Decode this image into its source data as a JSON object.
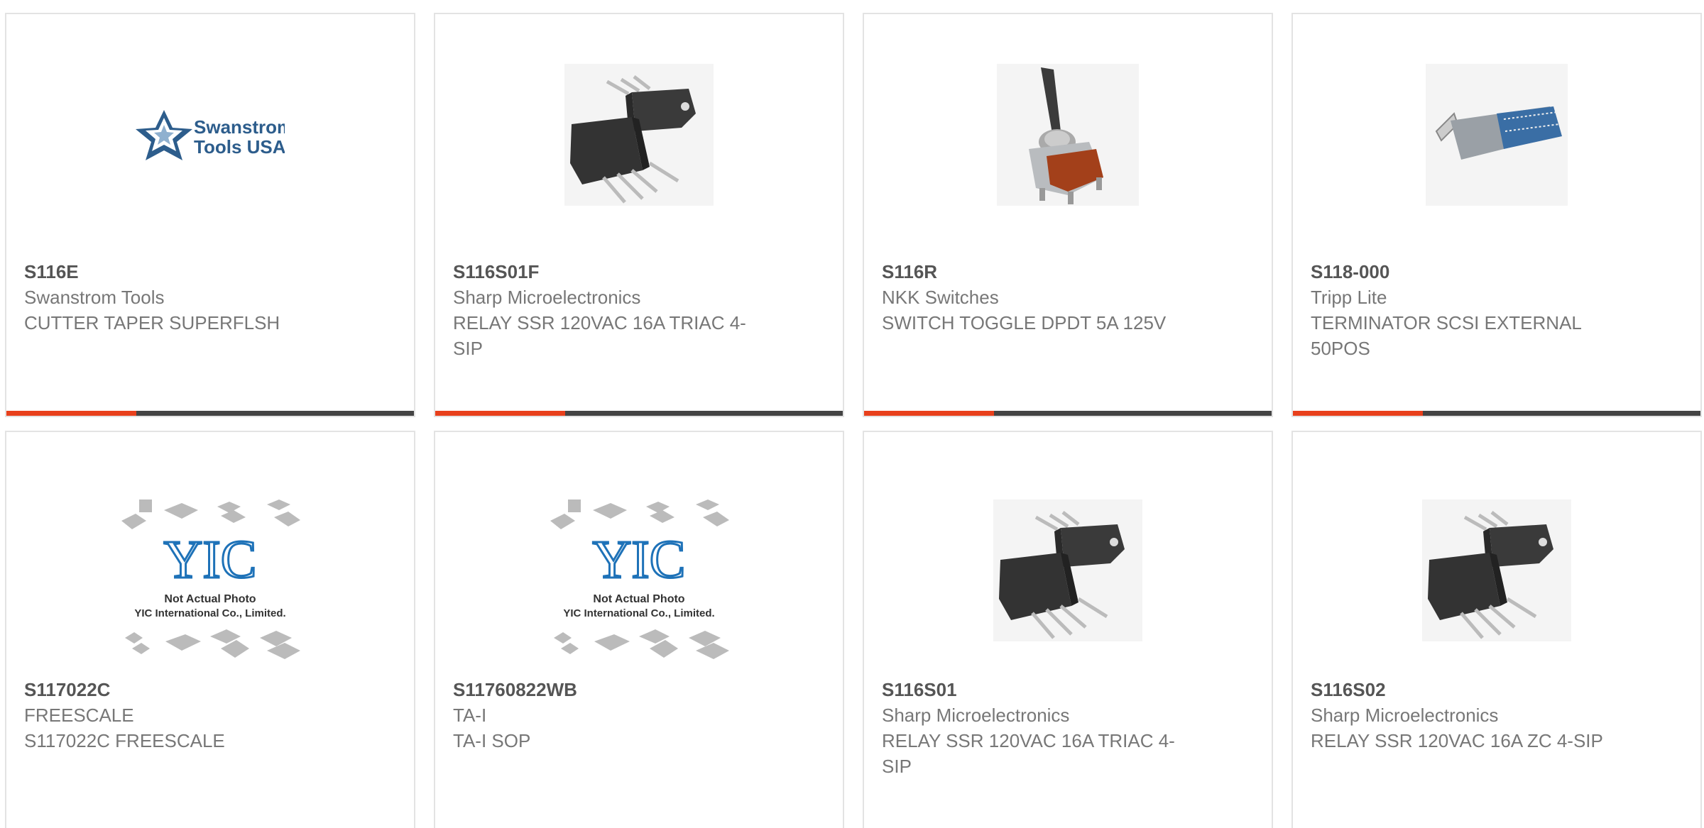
{
  "products": [
    {
      "pn": "S116E",
      "mfr": "Swanstrom Tools",
      "desc": "CUTTER TAPER SUPERFLSH",
      "image": "swanstrom-logo"
    },
    {
      "pn": "S116S01F",
      "mfr": "Sharp Microelectronics",
      "desc": "RELAY SSR 120VAC 16A TRIAC 4-SIP",
      "image": "relay"
    },
    {
      "pn": "S116R",
      "mfr": "NKK Switches",
      "desc": "SWITCH TOGGLE DPDT 5A 125V",
      "image": "toggle-switch"
    },
    {
      "pn": "S118-000",
      "mfr": "Tripp Lite",
      "desc": "TERMINATOR SCSI EXTERNAL 50POS",
      "image": "scsi-terminator"
    },
    {
      "pn": "S117022C",
      "mfr": "FREESCALE",
      "desc": "S117022C FREESCALE",
      "image": "not-actual-photo"
    },
    {
      "pn": "S11760822WB",
      "mfr": "TA-I",
      "desc": "TA-I SOP",
      "image": "not-actual-photo"
    },
    {
      "pn": "S116S01",
      "mfr": "Sharp Microelectronics",
      "desc": "RELAY SSR 120VAC 16A TRIAC 4-SIP",
      "image": "relay"
    },
    {
      "pn": "S116S02",
      "mfr": "Sharp Microelectronics",
      "desc": "RELAY SSR 120VAC 16A ZC 4-SIP",
      "image": "relay"
    }
  ],
  "logo": {
    "line1": "Swanstrom",
    "line2": "Tools USA"
  },
  "placeholder": {
    "line1": "Not Actual Photo",
    "line2": "YIC International Co., Limited.",
    "brand": "YIC"
  },
  "colors": {
    "accent": "#e8401c",
    "bar": "#444444"
  }
}
